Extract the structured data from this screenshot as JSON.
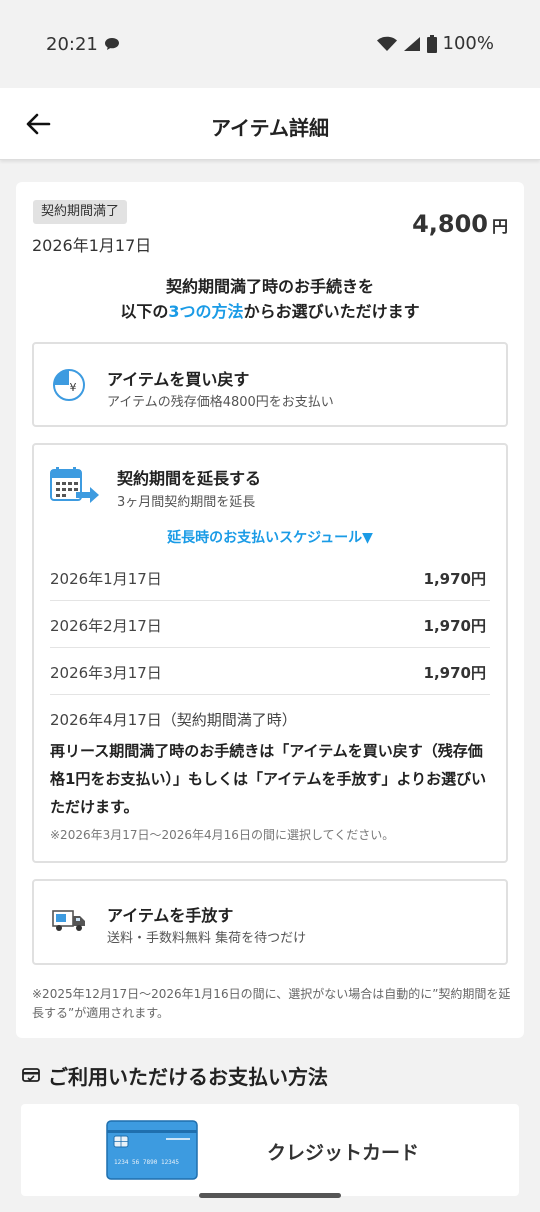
{
  "status_bar": {
    "time": "20:21",
    "battery": "100%"
  },
  "header": {
    "title": "アイテム詳細"
  },
  "summary": {
    "badge": "契約期間満了",
    "date": "2026年1月17日",
    "price": "4,800",
    "price_unit": "円",
    "intro_line1": "契約期間満了時のお手続きを",
    "intro_prefix": "以下の",
    "intro_accent": "3つの方法",
    "intro_suffix": "からお選びいただけます"
  },
  "options": {
    "buyback": {
      "title": "アイテムを買い戻す",
      "subtitle": "アイテムの残存価格4800円をお支払い"
    },
    "extend": {
      "title": "契約期間を延長する",
      "subtitle": "3ヶ月間契約期間を延長",
      "schedule_toggle": "延長時のお支払いスケジュール▼",
      "schedule": [
        {
          "date": "2026年1月17日",
          "amount": "1,970円"
        },
        {
          "date": "2026年2月17日",
          "amount": "1,970円"
        },
        {
          "date": "2026年3月17日",
          "amount": "1,970円"
        }
      ],
      "final_date": "2026年4月17日（契約期間満了時）",
      "final_note": "再リース期間満了時のお手続きは「アイテムを買い戻す（残存価格1円をお支払い）」もしくは「アイテムを手放す」よりお選びいただけます。",
      "final_small": "※2026年3月17日〜2026年4月16日の間に選択してください。"
    },
    "release": {
      "title": "アイテムを手放す",
      "subtitle": "送料・手数料無料 集荷を待つだけ"
    }
  },
  "footnote": "※2025年12月17日〜2026年1月16日の間に、選択がない場合は自動的に”契約期間を延長する”が適用されます。",
  "payment": {
    "section_title": "ご利用いただけるお支払い方法",
    "method_label": "クレジットカード",
    "card_number": "1234 56 7890 12345"
  },
  "colors": {
    "accent": "#1a9be6",
    "card_blue": "#3d9be0"
  }
}
